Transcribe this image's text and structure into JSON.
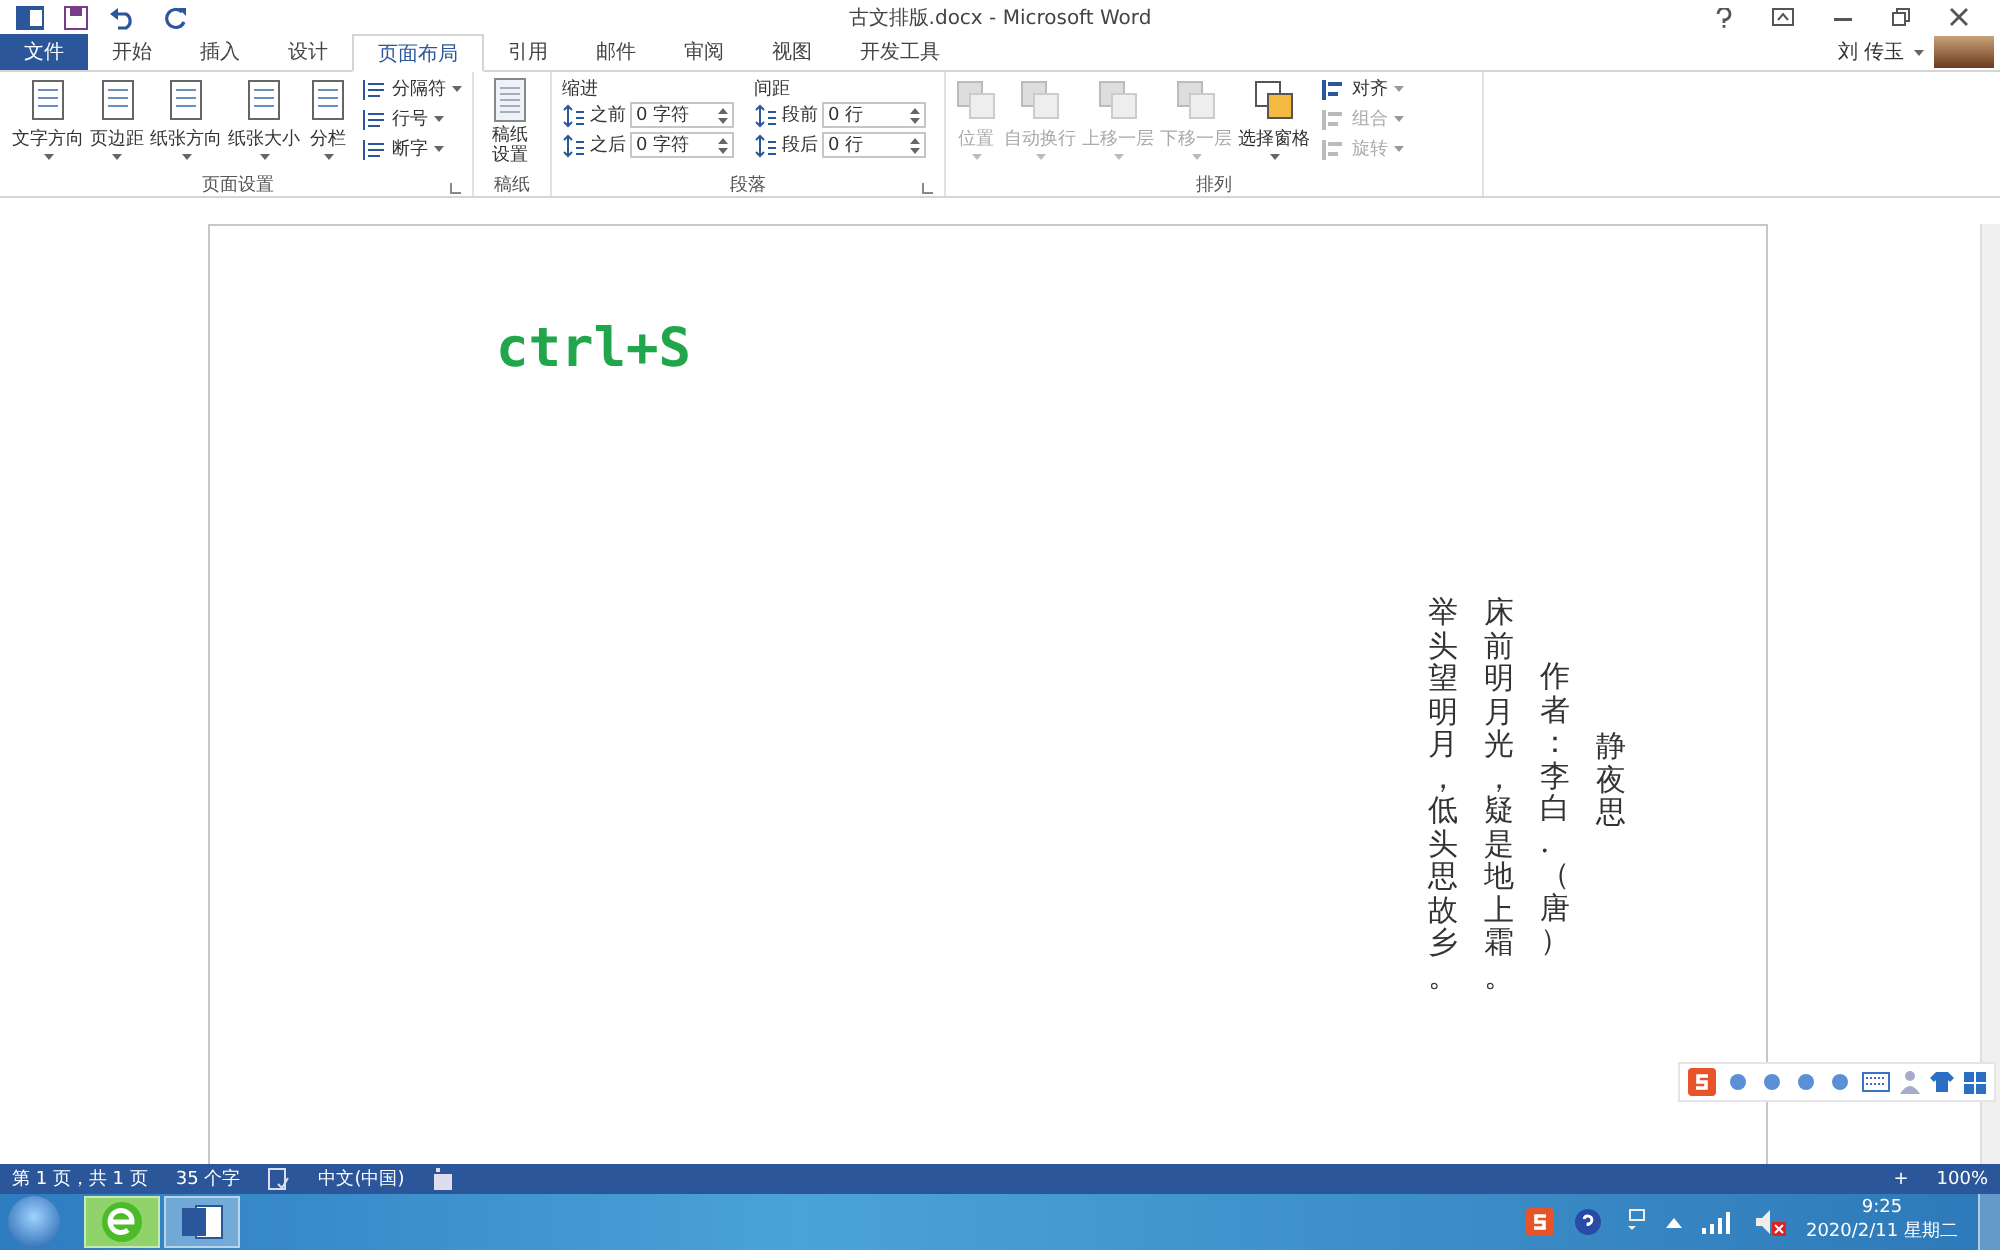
{
  "window": {
    "title": "古文排版.docx - Microsoft Word",
    "user": "刘 传玉"
  },
  "tabs": [
    {
      "label": "文件",
      "kind": "file",
      "selected": false
    },
    {
      "label": "开始",
      "kind": "tab",
      "selected": false
    },
    {
      "label": "插入",
      "kind": "tab",
      "selected": false
    },
    {
      "label": "设计",
      "kind": "tab",
      "selected": false
    },
    {
      "label": "页面布局",
      "kind": "tab",
      "selected": true
    },
    {
      "label": "引用",
      "kind": "tab",
      "selected": false
    },
    {
      "label": "邮件",
      "kind": "tab",
      "selected": false
    },
    {
      "label": "审阅",
      "kind": "tab",
      "selected": false
    },
    {
      "label": "视图",
      "kind": "tab",
      "selected": false
    },
    {
      "label": "开发工具",
      "kind": "tab",
      "selected": false
    }
  ],
  "ribbon": {
    "page_setup": {
      "title": "页面设置",
      "big": [
        "文字方向",
        "页边距",
        "纸张方向",
        "纸张大小",
        "分栏"
      ],
      "small": [
        "分隔符",
        "行号",
        "断字"
      ]
    },
    "manuscript": {
      "title": "稿纸",
      "button": "稿纸设置"
    },
    "paragraph": {
      "title": "段落",
      "indent_label": "缩进",
      "spacing_label": "间距",
      "indent": [
        {
          "label": "之前",
          "value": "0 字符"
        },
        {
          "label": "之后",
          "value": "0 字符"
        }
      ],
      "spacing": [
        {
          "label": "段前",
          "value": "0 行"
        },
        {
          "label": "段后",
          "value": "0 行"
        }
      ]
    },
    "arrange": {
      "title": "排列",
      "big": [
        {
          "label": "位置",
          "disabled": true
        },
        {
          "label": "自动换行",
          "disabled": true
        },
        {
          "label": "上移一层",
          "disabled": true
        },
        {
          "label": "下移一层",
          "disabled": true
        },
        {
          "label": "选择窗格",
          "disabled": false
        }
      ],
      "small": [
        {
          "label": "对齐",
          "disabled": false
        },
        {
          "label": "组合",
          "disabled": true
        },
        {
          "label": "旋转",
          "disabled": true
        }
      ]
    }
  },
  "document": {
    "shortcut": "ctrl+S",
    "columns": [
      {
        "kind": "line",
        "text": "举头望明月，低头思故乡。"
      },
      {
        "kind": "line",
        "text": "床前明月光，疑是地上霜。"
      },
      {
        "kind": "author",
        "text": "作者：李白.（唐）"
      },
      {
        "kind": "title",
        "text": "静夜思"
      }
    ]
  },
  "status_bar": {
    "page": "第 1 页，共 1 页",
    "words": "35 个字",
    "language": "中文(中国)",
    "zoom_in": "+",
    "zoom": "100%"
  },
  "taskbar": {
    "time": "9:25",
    "date": "2020/2/11 星期二"
  }
}
